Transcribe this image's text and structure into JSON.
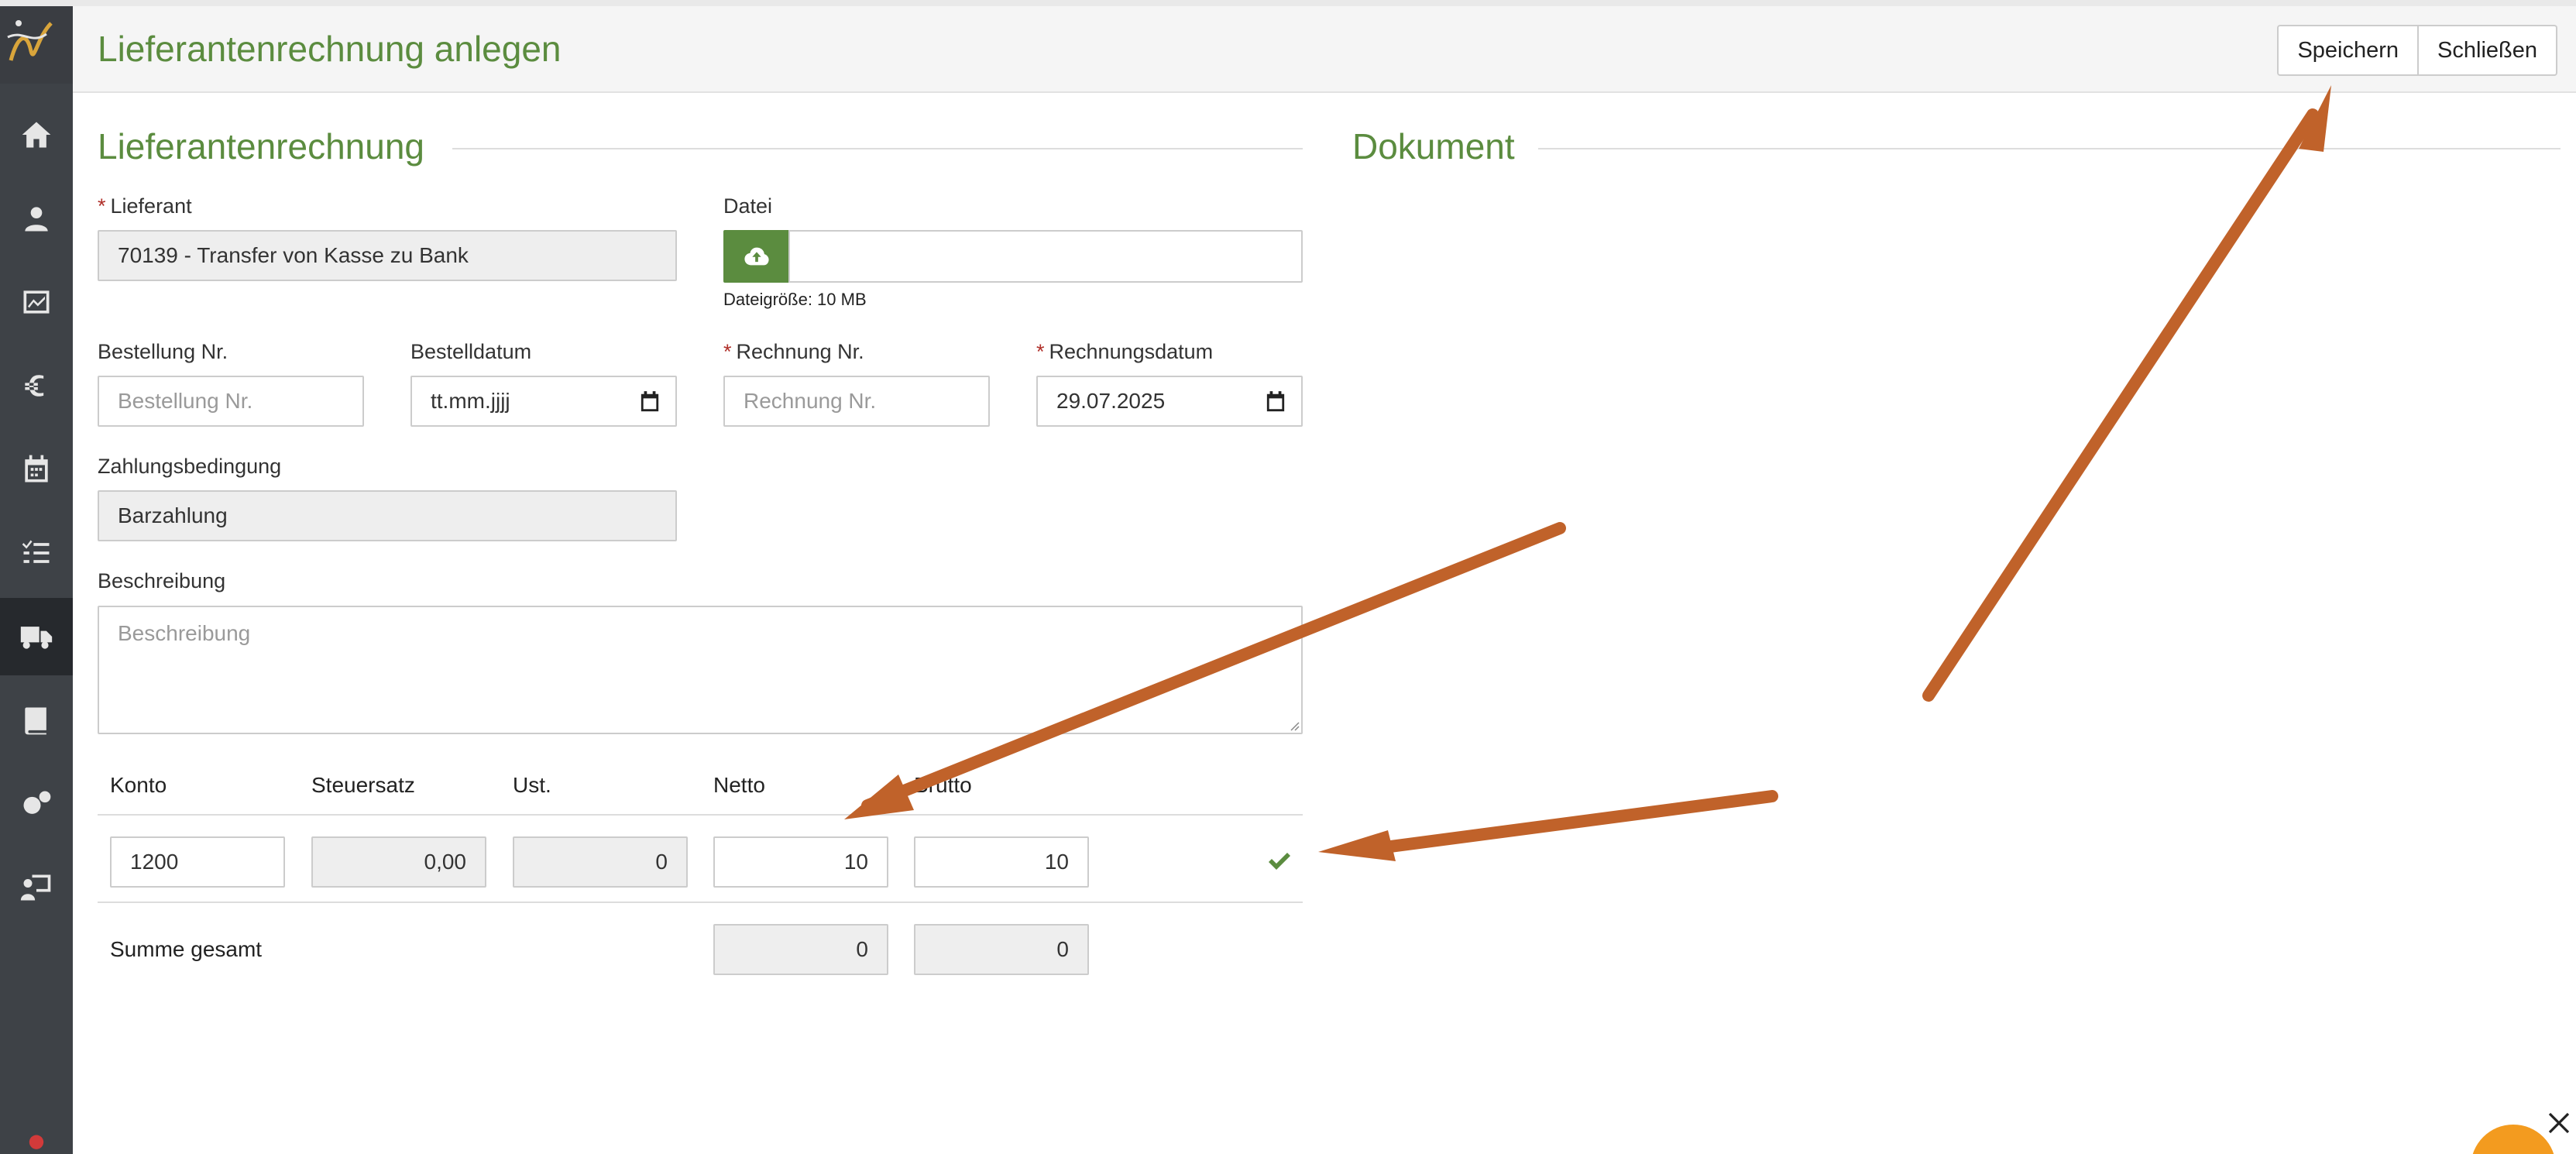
{
  "header": {
    "title": "Lieferantenrechnung anlegen",
    "save_label": "Speichern",
    "close_label": "Schließen"
  },
  "sections": {
    "invoice_title": "Lieferantenrechnung",
    "document_title": "Dokument"
  },
  "form": {
    "supplier": {
      "label": "Lieferant",
      "value": "70139 - Transfer von Kasse zu Bank"
    },
    "file": {
      "label": "Datei",
      "hint": "Dateigröße: 10 MB"
    },
    "order_no": {
      "label": "Bestellung Nr.",
      "placeholder": "Bestellung Nr."
    },
    "order_date": {
      "label": "Bestelldatum",
      "value": "tt.mm.jjjj"
    },
    "invoice_no": {
      "label": "Rechnung Nr.",
      "placeholder": "Rechnung Nr."
    },
    "invoice_date": {
      "label": "Rechnungsdatum",
      "value": "29.07.2025"
    },
    "payment_terms": {
      "label": "Zahlungsbedingung",
      "value": "Barzahlung"
    },
    "description": {
      "label": "Beschreibung",
      "placeholder": "Beschreibung"
    },
    "required_marker": "*"
  },
  "table": {
    "headers": {
      "account": "Konto",
      "tax_rate": "Steuersatz",
      "vat": "Ust.",
      "net": "Netto",
      "gross": "Brutto"
    },
    "row": {
      "account": "1200",
      "tax_rate": "0,00",
      "vat": "0",
      "net": "10",
      "gross": "10"
    },
    "total": {
      "label": "Summe gesamt",
      "net": "0",
      "gross": "0"
    }
  },
  "colors": {
    "accent_green": "#5b8c3f",
    "sidebar": "#3e4247",
    "annotation_arrow": "#c0622a",
    "required": "#b0302a"
  },
  "sidebar": {
    "icons": [
      "logo-icon",
      "home-icon",
      "contacts-icon",
      "dashboard-icon",
      "euro-icon",
      "calendar-icon",
      "tasks-icon",
      "truck-icon",
      "book-icon",
      "settings-icon",
      "presentation-icon",
      "user-icon"
    ],
    "active": "truck-icon"
  }
}
